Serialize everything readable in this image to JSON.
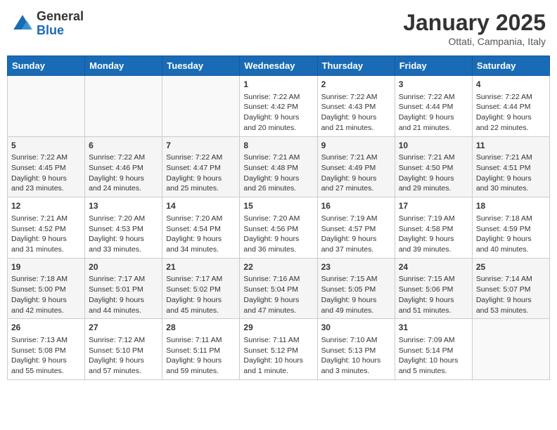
{
  "header": {
    "logo_general": "General",
    "logo_blue": "Blue",
    "month": "January 2025",
    "location": "Ottati, Campania, Italy"
  },
  "days_of_week": [
    "Sunday",
    "Monday",
    "Tuesday",
    "Wednesday",
    "Thursday",
    "Friday",
    "Saturday"
  ],
  "weeks": [
    [
      {
        "day": "",
        "info": ""
      },
      {
        "day": "",
        "info": ""
      },
      {
        "day": "",
        "info": ""
      },
      {
        "day": "1",
        "info": "Sunrise: 7:22 AM\nSunset: 4:42 PM\nDaylight: 9 hours\nand 20 minutes."
      },
      {
        "day": "2",
        "info": "Sunrise: 7:22 AM\nSunset: 4:43 PM\nDaylight: 9 hours\nand 21 minutes."
      },
      {
        "day": "3",
        "info": "Sunrise: 7:22 AM\nSunset: 4:44 PM\nDaylight: 9 hours\nand 21 minutes."
      },
      {
        "day": "4",
        "info": "Sunrise: 7:22 AM\nSunset: 4:44 PM\nDaylight: 9 hours\nand 22 minutes."
      }
    ],
    [
      {
        "day": "5",
        "info": "Sunrise: 7:22 AM\nSunset: 4:45 PM\nDaylight: 9 hours\nand 23 minutes."
      },
      {
        "day": "6",
        "info": "Sunrise: 7:22 AM\nSunset: 4:46 PM\nDaylight: 9 hours\nand 24 minutes."
      },
      {
        "day": "7",
        "info": "Sunrise: 7:22 AM\nSunset: 4:47 PM\nDaylight: 9 hours\nand 25 minutes."
      },
      {
        "day": "8",
        "info": "Sunrise: 7:21 AM\nSunset: 4:48 PM\nDaylight: 9 hours\nand 26 minutes."
      },
      {
        "day": "9",
        "info": "Sunrise: 7:21 AM\nSunset: 4:49 PM\nDaylight: 9 hours\nand 27 minutes."
      },
      {
        "day": "10",
        "info": "Sunrise: 7:21 AM\nSunset: 4:50 PM\nDaylight: 9 hours\nand 29 minutes."
      },
      {
        "day": "11",
        "info": "Sunrise: 7:21 AM\nSunset: 4:51 PM\nDaylight: 9 hours\nand 30 minutes."
      }
    ],
    [
      {
        "day": "12",
        "info": "Sunrise: 7:21 AM\nSunset: 4:52 PM\nDaylight: 9 hours\nand 31 minutes."
      },
      {
        "day": "13",
        "info": "Sunrise: 7:20 AM\nSunset: 4:53 PM\nDaylight: 9 hours\nand 33 minutes."
      },
      {
        "day": "14",
        "info": "Sunrise: 7:20 AM\nSunset: 4:54 PM\nDaylight: 9 hours\nand 34 minutes."
      },
      {
        "day": "15",
        "info": "Sunrise: 7:20 AM\nSunset: 4:56 PM\nDaylight: 9 hours\nand 36 minutes."
      },
      {
        "day": "16",
        "info": "Sunrise: 7:19 AM\nSunset: 4:57 PM\nDaylight: 9 hours\nand 37 minutes."
      },
      {
        "day": "17",
        "info": "Sunrise: 7:19 AM\nSunset: 4:58 PM\nDaylight: 9 hours\nand 39 minutes."
      },
      {
        "day": "18",
        "info": "Sunrise: 7:18 AM\nSunset: 4:59 PM\nDaylight: 9 hours\nand 40 minutes."
      }
    ],
    [
      {
        "day": "19",
        "info": "Sunrise: 7:18 AM\nSunset: 5:00 PM\nDaylight: 9 hours\nand 42 minutes."
      },
      {
        "day": "20",
        "info": "Sunrise: 7:17 AM\nSunset: 5:01 PM\nDaylight: 9 hours\nand 44 minutes."
      },
      {
        "day": "21",
        "info": "Sunrise: 7:17 AM\nSunset: 5:02 PM\nDaylight: 9 hours\nand 45 minutes."
      },
      {
        "day": "22",
        "info": "Sunrise: 7:16 AM\nSunset: 5:04 PM\nDaylight: 9 hours\nand 47 minutes."
      },
      {
        "day": "23",
        "info": "Sunrise: 7:15 AM\nSunset: 5:05 PM\nDaylight: 9 hours\nand 49 minutes."
      },
      {
        "day": "24",
        "info": "Sunrise: 7:15 AM\nSunset: 5:06 PM\nDaylight: 9 hours\nand 51 minutes."
      },
      {
        "day": "25",
        "info": "Sunrise: 7:14 AM\nSunset: 5:07 PM\nDaylight: 9 hours\nand 53 minutes."
      }
    ],
    [
      {
        "day": "26",
        "info": "Sunrise: 7:13 AM\nSunset: 5:08 PM\nDaylight: 9 hours\nand 55 minutes."
      },
      {
        "day": "27",
        "info": "Sunrise: 7:12 AM\nSunset: 5:10 PM\nDaylight: 9 hours\nand 57 minutes."
      },
      {
        "day": "28",
        "info": "Sunrise: 7:11 AM\nSunset: 5:11 PM\nDaylight: 9 hours\nand 59 minutes."
      },
      {
        "day": "29",
        "info": "Sunrise: 7:11 AM\nSunset: 5:12 PM\nDaylight: 10 hours\nand 1 minute."
      },
      {
        "day": "30",
        "info": "Sunrise: 7:10 AM\nSunset: 5:13 PM\nDaylight: 10 hours\nand 3 minutes."
      },
      {
        "day": "31",
        "info": "Sunrise: 7:09 AM\nSunset: 5:14 PM\nDaylight: 10 hours\nand 5 minutes."
      },
      {
        "day": "",
        "info": ""
      }
    ]
  ]
}
